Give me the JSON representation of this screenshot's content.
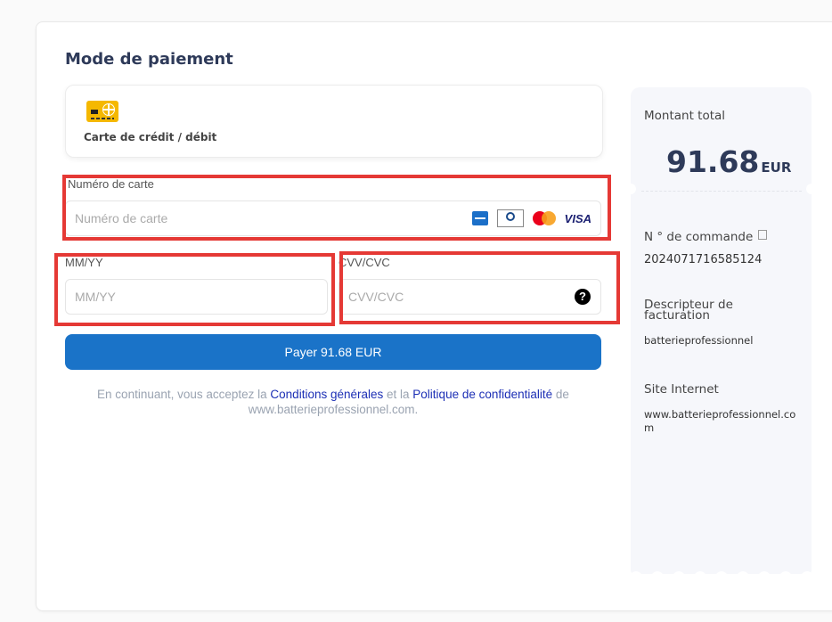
{
  "payment": {
    "title": "Mode de paiement",
    "method_label": "Carte de crédit / débit",
    "method_icon": "credit-card-icon"
  },
  "fields": {
    "card_number": {
      "label": "Numéro de carte",
      "placeholder": "Numéro de carte"
    },
    "expiry": {
      "label": "MM/YY",
      "placeholder": "MM/YY"
    },
    "cvv": {
      "label": "CVV/CVC",
      "placeholder": "CVV/CVC",
      "help_glyph": "?"
    }
  },
  "brands": [
    "amex-icon",
    "diners-club-icon",
    "mastercard-icon",
    "visa-icon"
  ],
  "brand_text": {
    "visa": "VISA"
  },
  "pay_button": "Payer 91.68 EUR",
  "terms": {
    "prefix": "En continuant, vous acceptez la ",
    "link1": "Conditions générales",
    "middle": " et la ",
    "link2": "Politique de confidentialité",
    "suffix": " de www.batterieprofessionnel.com."
  },
  "summary": {
    "total_label": "Montant total",
    "amount": "91.68",
    "currency": "EUR",
    "order_label": "N ° de commande",
    "order_number": "2024071716585124",
    "descriptor_label": "Descripteur de facturation",
    "descriptor_value": "batterieprofessionnel",
    "site_label": "Site Internet",
    "site_value": "www.batterieprofessionnel.com"
  },
  "colors": {
    "primary": "#1a73c8",
    "highlight": "#e53935",
    "link": "#1c2fb5",
    "card_gold": "#f5b800"
  }
}
